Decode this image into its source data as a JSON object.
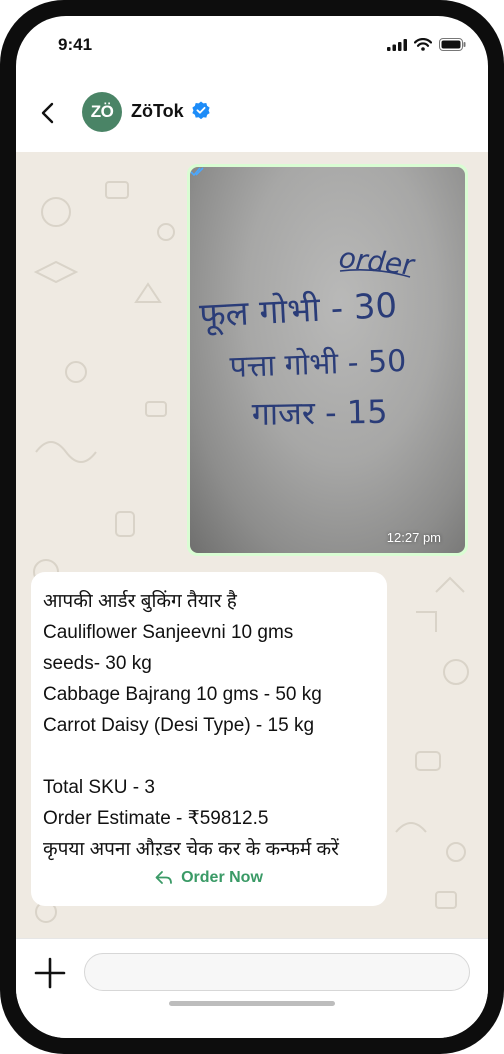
{
  "status_bar": {
    "time": "9:41",
    "icons": [
      "signal-icon",
      "wifi-icon",
      "battery-icon"
    ]
  },
  "header": {
    "avatar_text": "ZÖ",
    "contact_name": "ZöTok",
    "icons": [
      "back-icon",
      "verified-badge-icon"
    ]
  },
  "image_message": {
    "handwritten_text": [
      "order",
      "फूल गोभी - 30",
      "पत्ता गोभी - 50",
      "गाजर - 15"
    ],
    "time": "12:27 pm",
    "status_icon": "double-check-icon"
  },
  "text_message": {
    "lines": [
      "आपकी आर्डर बुकिंग तैयार  है",
      "Cauliflower Sanjeevni 10 gms",
      "seeds- 30 kg",
      "Cabbage Bajrang 10 gms - 50 kg",
      "Carrot Daisy (Desi Type) - 15 kg",
      "",
      "Total SKU - 3",
      "Order Estimate - ₹59812.5",
      "कृपया अपना औऱडर चेक कर के कन्फर्म करें"
    ],
    "action_label": "Order Now",
    "action_icon": "reply-arrow-icon"
  },
  "input_bar": {
    "placeholder": "",
    "value": "",
    "icons": [
      "plus-icon"
    ]
  },
  "colors": {
    "accent_green": "#3a9a66",
    "avatar_green": "#4a8466",
    "outgoing_bubble": "#d9fdd3",
    "chat_background": "#efeae2",
    "verified_blue": "#1d8cf8"
  }
}
